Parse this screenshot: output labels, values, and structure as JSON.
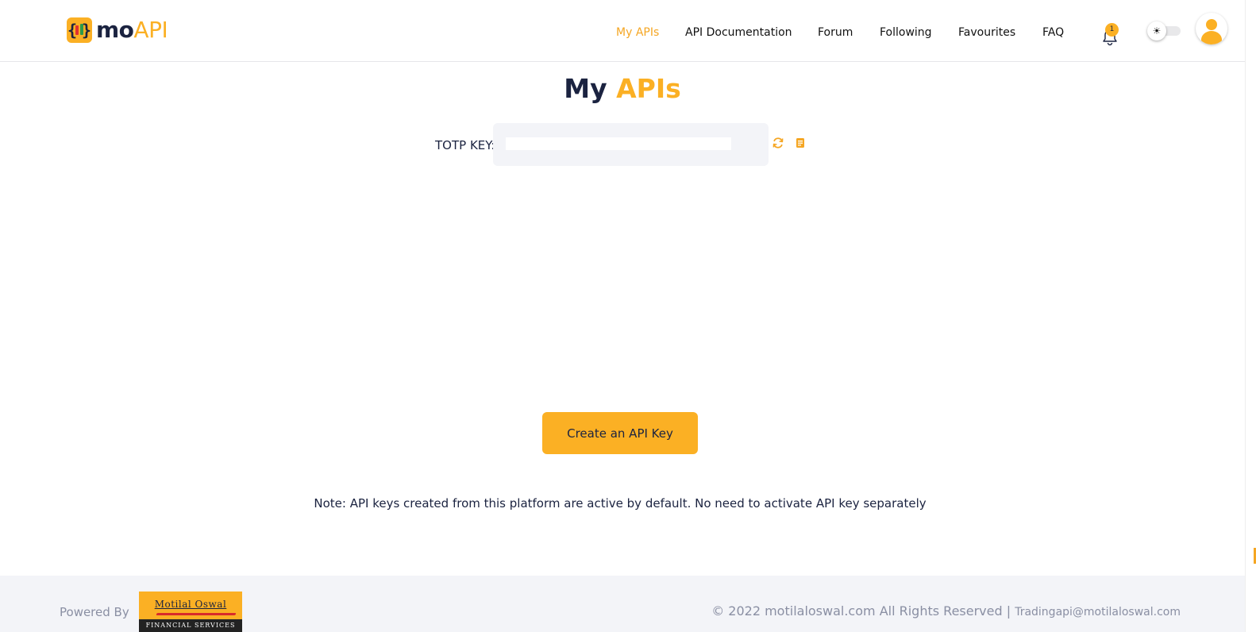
{
  "header": {
    "logo": {
      "mo": "mo",
      "api": "API"
    },
    "nav": [
      {
        "label": "My APIs",
        "active": true
      },
      {
        "label": "API Documentation",
        "active": false
      },
      {
        "label": "Forum",
        "active": false
      },
      {
        "label": "Following",
        "active": false
      },
      {
        "label": "Favourites",
        "active": false
      },
      {
        "label": "FAQ",
        "active": false
      }
    ],
    "notification_count": "1",
    "theme_toggle_icon": "☀"
  },
  "main": {
    "title_part1": "My",
    "title_part2": "APIs",
    "totp_label": "TOTP KEY:",
    "totp_value": "",
    "create_button": "Create an API Key",
    "note": "Note: API keys created from this platform are active by default. No need to activate API key separately"
  },
  "footer": {
    "powered_by": "Powered By",
    "partner_logo_name": "Motilal Oswal",
    "partner_logo_sub": "FINANCIAL SERVICES",
    "copyright": "© 2022 motilaloswal.com All Rights Reserved |",
    "email": "Tradingapi@motilaloswal.com"
  },
  "colors": {
    "accent": "#fbb024",
    "primary_text": "#1b2340",
    "muted_text": "#8a8fa3",
    "footer_bg": "#f3f4f8"
  }
}
